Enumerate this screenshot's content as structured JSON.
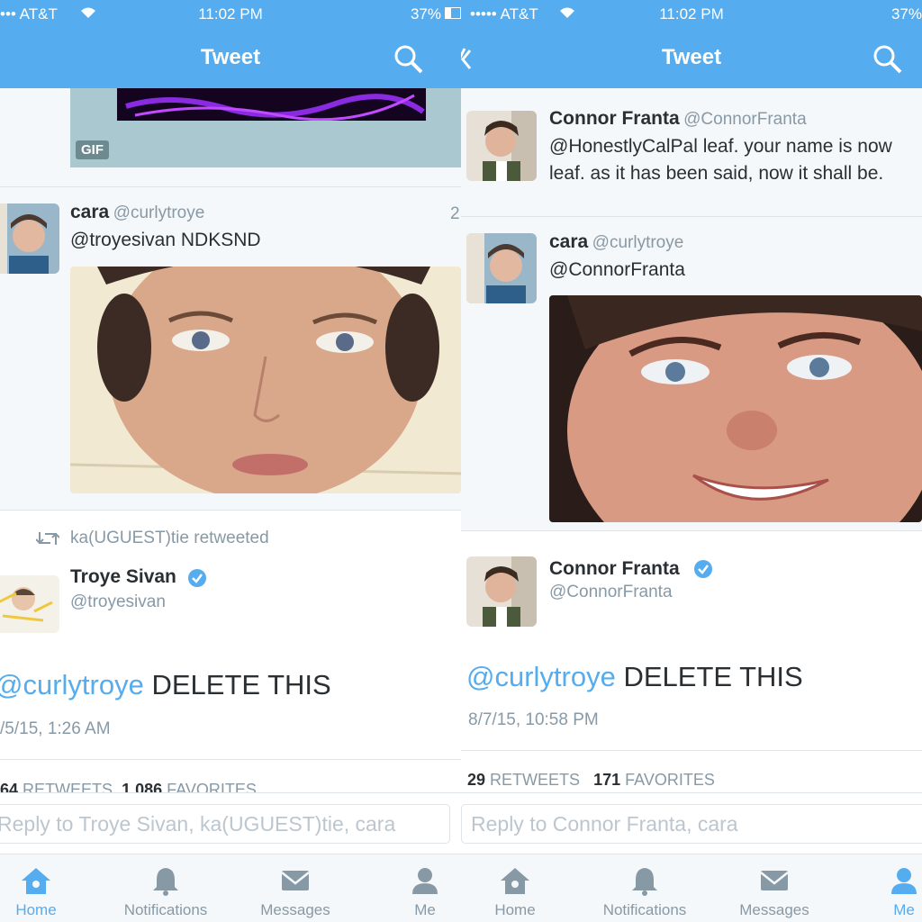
{
  "colors": {
    "accent": "#55acee",
    "text": "#292f33",
    "muted": "#8899a6",
    "border": "#dfe4e8"
  },
  "left": {
    "status": {
      "carrier": "••• AT&T",
      "time": "11:02 PM",
      "battery": "37%"
    },
    "nav": {
      "title": "Tweet"
    },
    "gif_badge": "GIF",
    "tweet": {
      "name": "cara",
      "handle": "@curlytroye",
      "text": "@troyesivan NDKSND",
      "time": "2"
    },
    "retweet_note": "ka(UGUEST)tie retweeted",
    "author": {
      "name": "Troye Sivan",
      "handle": "@troyesivan"
    },
    "detail": {
      "mention": "@curlytroye",
      "text": " DELETE THIS",
      "timestamp": "/5/15, 1:26 AM",
      "retweets_count": "64",
      "retweets_label": "RETWEETS",
      "favorites_count": "1,086",
      "favorites_label": "FAVORITES"
    },
    "reply_placeholder": "Reply to Troye Sivan, ka(UGUEST)tie, cara",
    "tabs": [
      {
        "label": "Home",
        "icon": "home-icon"
      },
      {
        "label": "Notifications",
        "icon": "bell-icon"
      },
      {
        "label": "Messages",
        "icon": "envelope-icon"
      },
      {
        "label": "Me",
        "icon": "person-icon"
      }
    ]
  },
  "right": {
    "status": {
      "carrier": "••••• AT&T",
      "time": "11:02 PM",
      "battery": "37%"
    },
    "nav": {
      "title": "Tweet"
    },
    "parent": {
      "name": "Connor Franta",
      "handle": "@ConnorFranta",
      "line1": "@HonestlyCalPal leaf. your name is now",
      "line2": "leaf. as it has been said, now it shall be."
    },
    "tweet": {
      "name": "cara",
      "handle": "@curlytroye",
      "text": "@ConnorFranta"
    },
    "author": {
      "name": "Connor Franta",
      "handle": "@ConnorFranta"
    },
    "detail": {
      "mention": "@curlytroye",
      "text": " DELETE THIS",
      "timestamp": "8/7/15, 10:58 PM",
      "retweets_count": "29",
      "retweets_label": "RETWEETS",
      "favorites_count": "171",
      "favorites_label": "FAVORITES"
    },
    "reply_placeholder": "Reply to Connor Franta, cara",
    "tabs": [
      {
        "label": "Home",
        "icon": "home-icon"
      },
      {
        "label": "Notifications",
        "icon": "bell-icon"
      },
      {
        "label": "Messages",
        "icon": "envelope-icon"
      },
      {
        "label": "Me",
        "icon": "person-icon"
      }
    ]
  }
}
